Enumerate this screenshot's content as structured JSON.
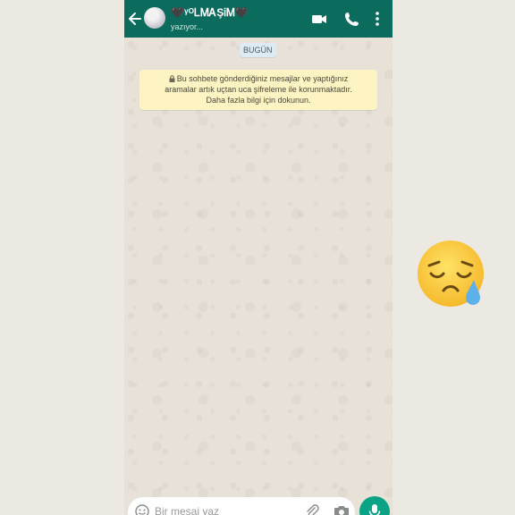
{
  "header": {
    "contact_name": "🖤ᵞᴼᏞᎷᎪŞᎥᎷ🖤",
    "status": "yazıyor..."
  },
  "chat": {
    "date_chip": "BUGÜN",
    "encryption_notice": {
      "line1": "Bu sohbete gönderdiğiniz mesajlar ve yaptığınız",
      "line2": "aramalar artık uçtan uca şifreleme ile korunmaktadır.",
      "line3": "Daha fazla bilgi için dokunun."
    }
  },
  "composer": {
    "placeholder": "Bir mesaj yaz"
  },
  "colors": {
    "header": "#0b6b5c",
    "accent": "#0aa386",
    "banner": "#fdf3c3"
  },
  "icons": [
    "back-arrow-icon",
    "video-call-icon",
    "phone-icon",
    "more-options-icon",
    "lock-icon",
    "emoji-icon",
    "attach-icon",
    "camera-icon",
    "mic-icon",
    "sleepy-face-emoji"
  ]
}
